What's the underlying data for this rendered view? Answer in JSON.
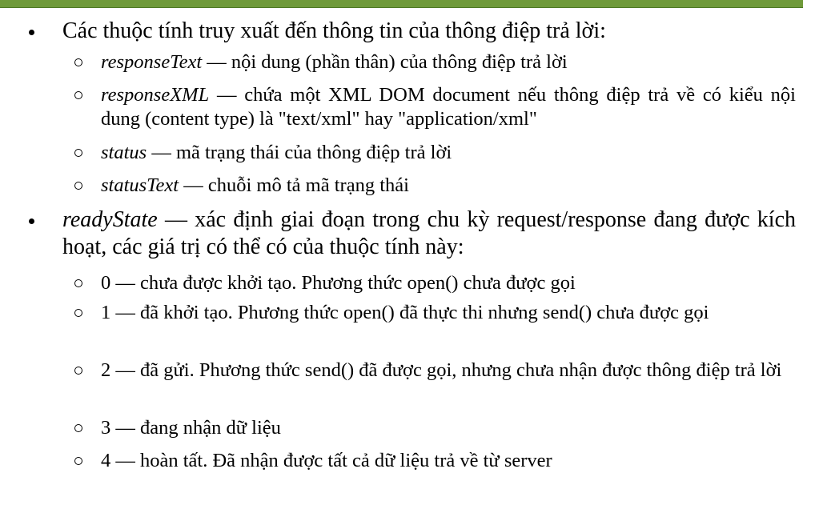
{
  "items": [
    {
      "term": "",
      "text": "Các thuộc tính truy xuất đến thông tin của thông điệp trả lời:"
    },
    {
      "term": "responseText",
      "text": " — nội dung (phần thân) của thông điệp trả lời"
    },
    {
      "term": "responseXML",
      "text": "   — chứa một XML DOM document nếu thông điệp trả về có kiểu nội dung (content type) là \"text/xml\" hay  \"application/xml\""
    },
    {
      "term": "status",
      "text": "  — mã trạng thái của thông điệp trả lời"
    },
    {
      "term": "statusText",
      "text": "  — chuỗi mô tả mã trạng thái"
    },
    {
      "term": "readyState",
      "text": " — xác định giai đoạn trong chu kỳ request/response đang được kích hoạt, các giá trị có thể có của thuộc tính này:"
    },
    {
      "term": "",
      "text": "0 — chưa được khởi tạo. Phương thức open() chưa được gọi"
    },
    {
      "term": "",
      "text": "1 — đã khởi tạo. Phương thức open() đã thực thi nhưng send() chưa được gọi"
    },
    {
      "term": "",
      "text": "2 — đã gửi. Phương thức send() đã được gọi, nhưng chưa nhận được thông điệp trả lời"
    },
    {
      "term": "",
      "text": "3 — đang nhận dữ liệu"
    },
    {
      "term": "",
      "text": "4 — hoàn tất. Đã nhận được tất cả dữ liệu trả về từ server"
    }
  ]
}
